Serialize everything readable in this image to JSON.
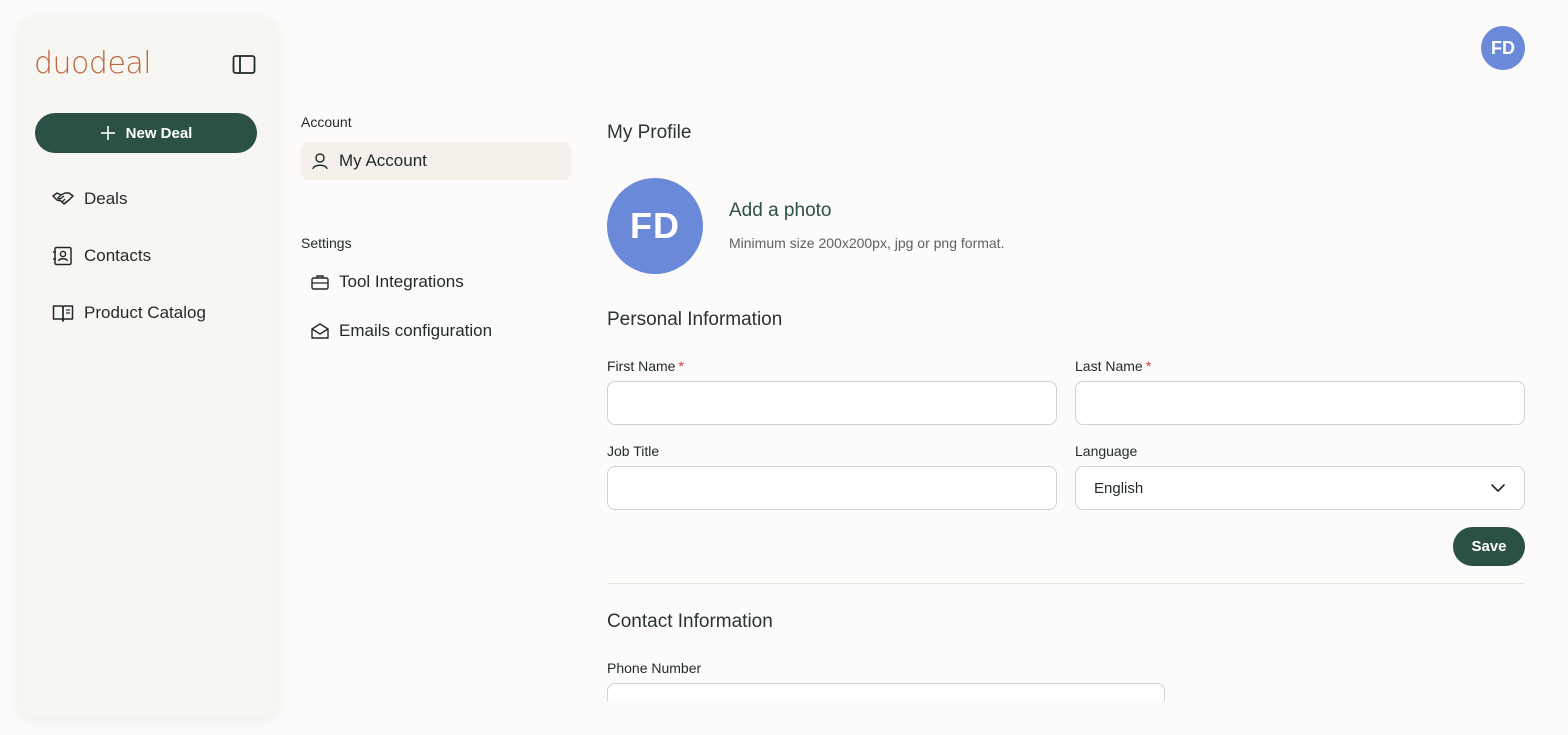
{
  "app": {
    "logo_text": "duodeal",
    "new_deal_label": "New Deal",
    "user_initials": "FD"
  },
  "sidebar": {
    "items": [
      {
        "label": "Deals",
        "icon": "handshake-icon"
      },
      {
        "label": "Contacts",
        "icon": "contact-card-icon"
      },
      {
        "label": "Product Catalog",
        "icon": "book-open-icon"
      }
    ]
  },
  "settings_menu": {
    "account_section": "Account",
    "my_account": "My Account",
    "settings_section": "Settings",
    "tool_integrations": "Tool Integrations",
    "emails_configuration": "Emails configuration"
  },
  "profile": {
    "title": "My Profile",
    "avatar_initials": "FD",
    "add_photo": "Add a photo",
    "photo_hint": "Minimum size 200x200px, jpg or png format."
  },
  "personal": {
    "title": "Personal Information",
    "first_name_label": "First Name",
    "first_name_value": "",
    "last_name_label": "Last Name",
    "last_name_value": "",
    "job_title_label": "Job Title",
    "job_title_value": "",
    "language_label": "Language",
    "language_value": "English",
    "required_mark": "*",
    "save_label": "Save"
  },
  "contact": {
    "title": "Contact Information",
    "phone_label": "Phone Number",
    "phone_value": ""
  },
  "colors": {
    "accent": "#2b5046",
    "avatar": "#6a8ad9",
    "logo": "#b8683f",
    "required": "#d9363e"
  }
}
